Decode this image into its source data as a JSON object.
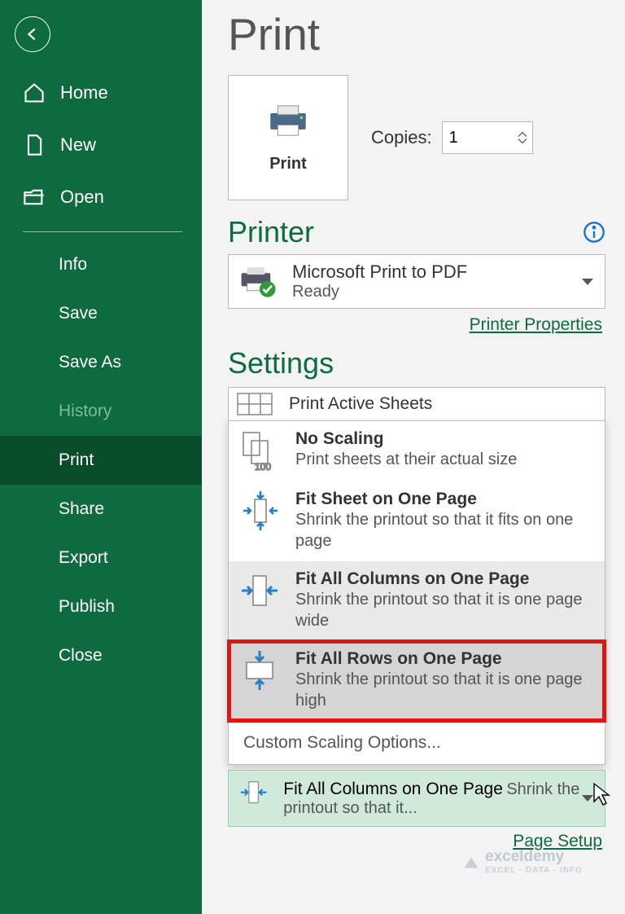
{
  "sidebar": {
    "items": [
      {
        "label": "Home"
      },
      {
        "label": "New"
      },
      {
        "label": "Open"
      },
      {
        "label": "Info"
      },
      {
        "label": "Save"
      },
      {
        "label": "Save As"
      },
      {
        "label": "History"
      },
      {
        "label": "Print"
      },
      {
        "label": "Share"
      },
      {
        "label": "Export"
      },
      {
        "label": "Publish"
      },
      {
        "label": "Close"
      }
    ]
  },
  "page": {
    "title": "Print",
    "print_button": "Print",
    "copies_label": "Copies:",
    "copies_value": "1"
  },
  "printer": {
    "header": "Printer",
    "name": "Microsoft Print to PDF",
    "status": "Ready",
    "properties_link": "Printer Properties"
  },
  "settings": {
    "header": "Settings",
    "active_sheets": "Print Active Sheets",
    "options": [
      {
        "title": "No Scaling",
        "desc": "Print sheets at their actual size",
        "sub100": "100"
      },
      {
        "title": "Fit Sheet on One Page",
        "desc": "Shrink the printout so that it fits on one page"
      },
      {
        "title": "Fit All Columns on One Page",
        "desc": "Shrink the printout so that it is one page wide"
      },
      {
        "title": "Fit All Rows on One Page",
        "desc": "Shrink the printout so that it is one page high"
      }
    ],
    "custom": "Custom Scaling Options...",
    "selected": {
      "title": "Fit All Columns on One Page",
      "desc": "Shrink the printout so that it..."
    },
    "page_setup_link": "Page Setup"
  },
  "watermark": {
    "brand": "exceldemy",
    "tag": "EXCEL · DATA · INFO"
  }
}
